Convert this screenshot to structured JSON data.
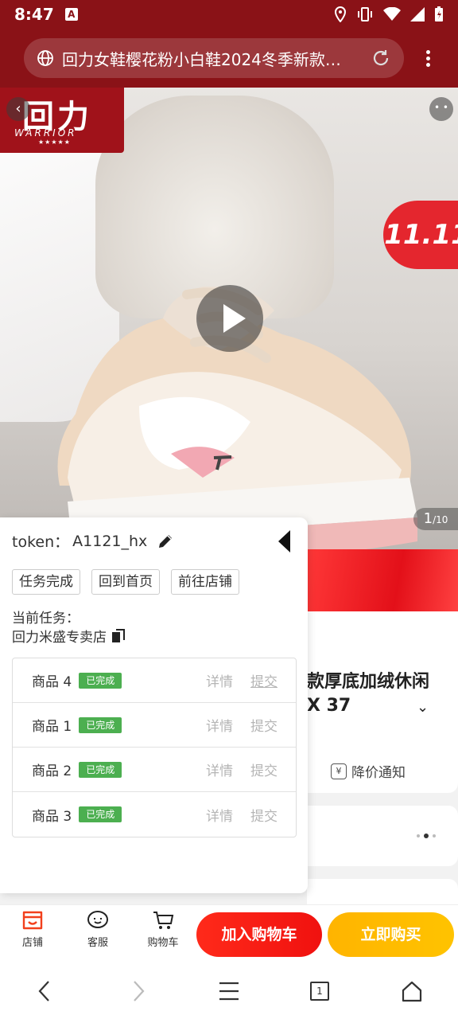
{
  "status_bar": {
    "time": "8:47",
    "app_badge": "A"
  },
  "browser": {
    "page_title": "回力女鞋樱花粉小白鞋2024冬季新款…",
    "icons": [
      "globe-icon",
      "reload-icon",
      "overflow-menu-icon"
    ]
  },
  "gallery": {
    "brand_big": "回力",
    "brand_small": "WARRIOR",
    "brand_stars": "★★★★★",
    "promo_label": "11.11",
    "more_label": "• •",
    "counter_current": "1",
    "counter_total": "/10"
  },
  "helper_panel": {
    "token_label": "token：",
    "token_value": "A1121_hx",
    "buttons": [
      "任务完成",
      "回到首页",
      "前往店铺"
    ],
    "task_label": "当前任务：",
    "task_shop": "回力米盛专卖店",
    "tasks": [
      {
        "name": "商品 4",
        "status": "已完成",
        "detail": "详情",
        "submit": "提交"
      },
      {
        "name": "商品 1",
        "status": "已完成",
        "detail": "详情",
        "submit": "提交"
      },
      {
        "name": "商品 2",
        "status": "已完成",
        "detail": "详情",
        "submit": "提交"
      },
      {
        "name": "商品 3",
        "status": "已完成",
        "detail": "详情",
        "submit": "提交"
      }
    ]
  },
  "product": {
    "title_line1": "款厚底加绒休闲",
    "title_line2": "X 37",
    "price_notice": "降价通知",
    "price_notice_icon": "¥"
  },
  "bottom_bar": {
    "shop_label": "店铺",
    "service_label": "客服",
    "cart_label": "购物车",
    "add_to_cart": "加入购物车",
    "buy_now": "立即购买"
  },
  "nav_bar": {
    "tab_count": "1"
  },
  "colors": {
    "brand_red": "#8a1217",
    "accent_red": "#f0110f",
    "accent_yellow": "#ffb400",
    "done_green": "#4caf50"
  }
}
